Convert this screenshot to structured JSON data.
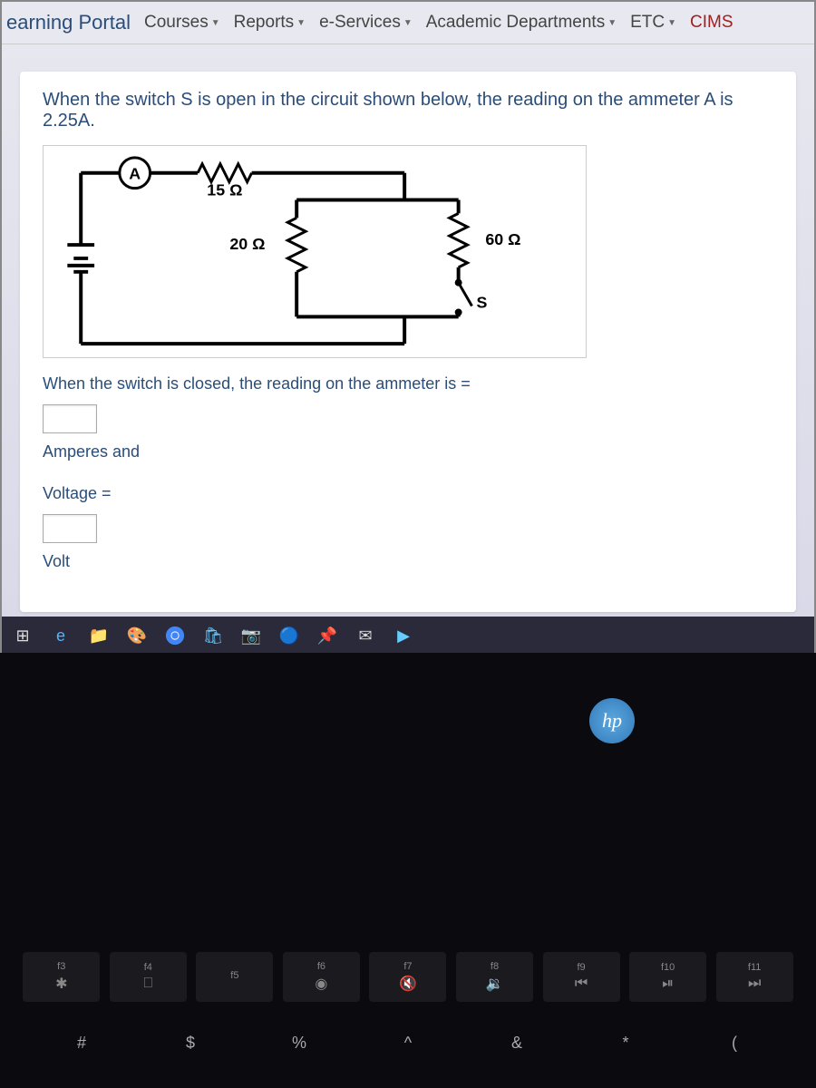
{
  "navbar": {
    "brand": "earning Portal",
    "items": [
      {
        "label": "Courses"
      },
      {
        "label": "Reports"
      },
      {
        "label": "e-Services"
      },
      {
        "label": "Academic Departments"
      },
      {
        "label": "ETC"
      },
      {
        "label": "CIMS"
      }
    ]
  },
  "question": {
    "intro": "When the switch S is open in the circuit shown below, the reading on the ammeter A is 2.25A.",
    "circuit": {
      "ammeter_label": "A",
      "r1_label": "15 Ω",
      "r2_label": "20 Ω",
      "r3_label": "60 Ω",
      "switch_label": "S"
    },
    "prompt": "When the switch is closed, the reading on the ammeter is =",
    "unit1_label": "Amperes and",
    "voltage_label": "Voltage =",
    "unit2_label": "Volt"
  },
  "laptop": {
    "brand": "hp",
    "fn_keys": [
      {
        "label": "f3",
        "icon": "✱"
      },
      {
        "label": "f4",
        "icon": "⎕"
      },
      {
        "label": "f5",
        "icon": ""
      },
      {
        "label": "f6",
        "icon": "◉"
      },
      {
        "label": "f7",
        "icon": "🔇"
      },
      {
        "label": "f8",
        "icon": "🔉"
      },
      {
        "label": "f9",
        "icon": "⏮"
      },
      {
        "label": "f10",
        "icon": "⏯"
      },
      {
        "label": "f11",
        "icon": "⏭"
      }
    ],
    "num_keys": [
      "#",
      "$",
      "%",
      "^",
      "&",
      "*",
      "("
    ]
  }
}
